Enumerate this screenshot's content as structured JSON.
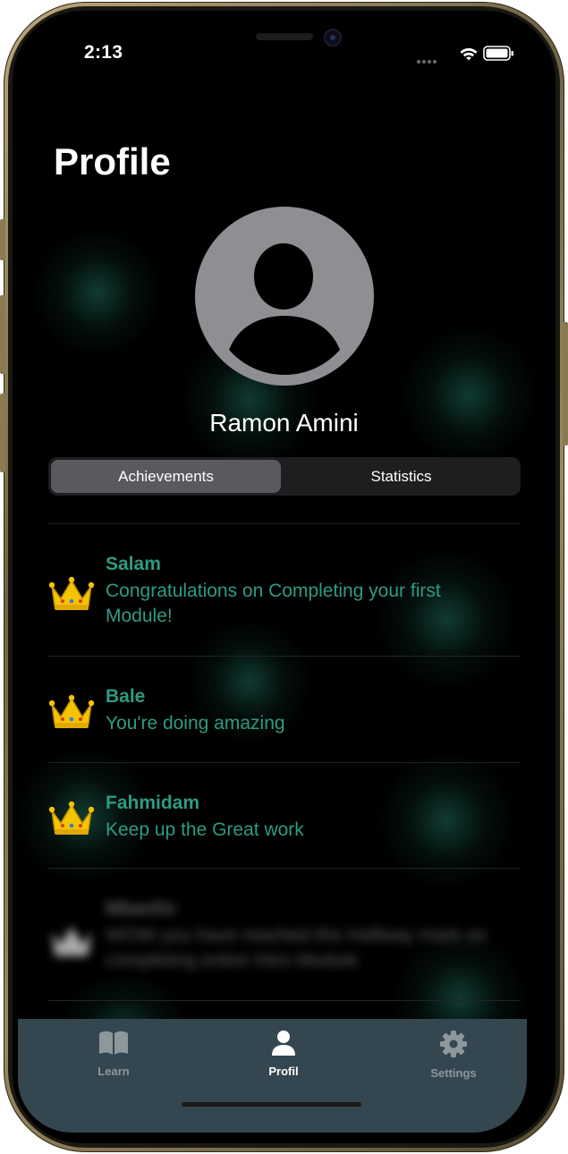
{
  "status_bar": {
    "time": "2:13",
    "icons": [
      "signal-dots-icon",
      "wifi-icon",
      "battery-icon"
    ]
  },
  "header": {
    "title": "Profile"
  },
  "profile": {
    "name": "Ramon Amini",
    "avatar_icon": "person-circle-icon"
  },
  "segments": [
    {
      "label": "Achievements",
      "selected": true
    },
    {
      "label": "Statistics",
      "selected": false
    }
  ],
  "achievements": [
    {
      "icon": "crown-icon",
      "title": "Salam",
      "description": "Congratulations on Completing your first Module!"
    },
    {
      "icon": "crown-icon",
      "title": "Bale",
      "description": "You're doing amazing"
    },
    {
      "icon": "crown-icon",
      "title": "Fahmidam",
      "description": "Keep up the Great work"
    },
    {
      "icon": "crown-icon",
      "title": "Mbaslin",
      "description": "WOW you have reached the Halfway mark on completing entire Intro Module",
      "locked": true
    }
  ],
  "tabbar": {
    "items": [
      {
        "label": "Learn",
        "icon": "book-icon",
        "active": false
      },
      {
        "label": "Profil",
        "icon": "person-icon",
        "active": true
      },
      {
        "label": "Settings",
        "icon": "gear-icon",
        "active": false
      }
    ]
  },
  "colors": {
    "accent": "#2E9B82",
    "crown": "#F5C400",
    "tabbar_bg": "#34464F",
    "background": "#000000"
  }
}
